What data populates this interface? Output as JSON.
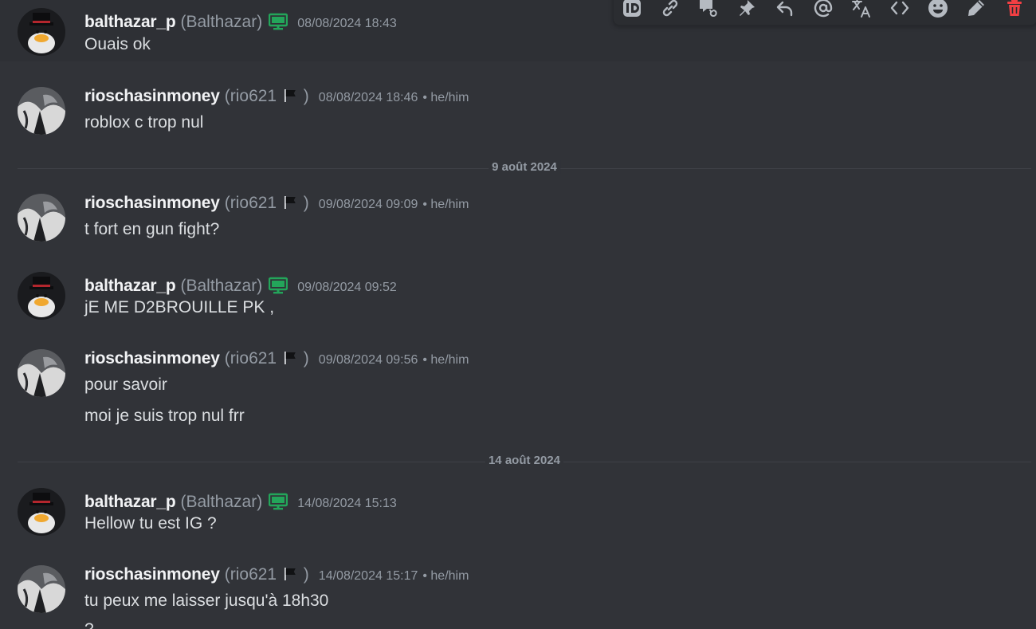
{
  "messages": [
    {
      "username": "balthazar_p",
      "display": "(Balthazar)",
      "timestamp": "08/08/2024 18:43",
      "lines": [
        "Ouais ok"
      ]
    },
    {
      "username": "rioschasinmoney",
      "display_pre": "(rio621",
      "display_post": ")",
      "timestamp": "08/08/2024 18:46",
      "pronoun": "• he/him",
      "lines": [
        "roblox c trop nul"
      ]
    },
    {
      "username": "rioschasinmoney",
      "display_pre": "(rio621",
      "display_post": ")",
      "timestamp": "09/08/2024 09:09",
      "pronoun": "• he/him",
      "lines": [
        "t fort en gun fight?"
      ]
    },
    {
      "username": "balthazar_p",
      "display": "(Balthazar)",
      "timestamp": "09/08/2024 09:52",
      "lines": [
        "jE ME D2BROUILLE PK ,"
      ]
    },
    {
      "username": "rioschasinmoney",
      "display_pre": "(rio621",
      "display_post": ")",
      "timestamp": "09/08/2024 09:56",
      "pronoun": "• he/him",
      "lines": [
        "pour savoir",
        "moi je suis trop nul frr"
      ]
    },
    {
      "username": "balthazar_p",
      "display": "(Balthazar)",
      "timestamp": "14/08/2024 15:13",
      "lines": [
        "Hellow tu est IG ?"
      ]
    },
    {
      "username": "rioschasinmoney",
      "display_pre": "(rio621",
      "display_post": ")",
      "timestamp": "14/08/2024 15:17",
      "pronoun": "• he/him",
      "lines": [
        "tu peux me laisser jusqu'à 18h30",
        "?"
      ]
    }
  ],
  "dividers": [
    "9 août 2024",
    "14 août 2024"
  ],
  "toolbar_icons": [
    "id-icon",
    "link-icon",
    "forward-icon",
    "pin-icon",
    "reply-icon",
    "mention-icon",
    "translate-icon",
    "code-icon",
    "emoji-icon",
    "edit-icon",
    "trash-icon"
  ],
  "colors": {
    "background": "#313338",
    "status_online": "#23a55a",
    "danger": "#f23f43"
  }
}
